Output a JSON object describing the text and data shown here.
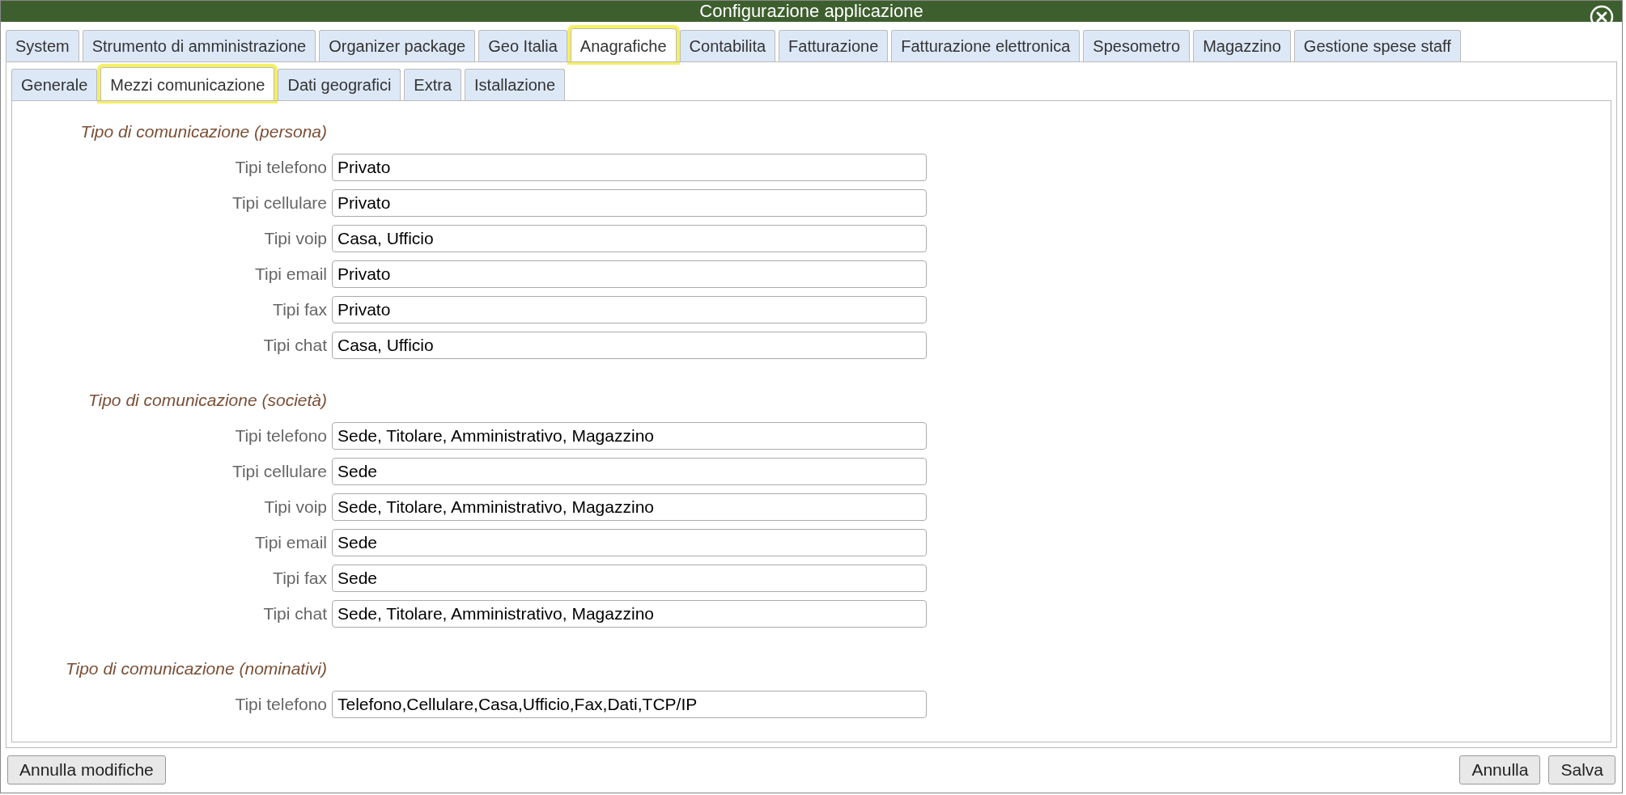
{
  "window": {
    "title": "Configurazione applicazione"
  },
  "tabs": [
    {
      "label": "System",
      "selected": false
    },
    {
      "label": "Strumento di amministrazione",
      "selected": false
    },
    {
      "label": "Organizer package",
      "selected": false
    },
    {
      "label": "Geo Italia",
      "selected": false
    },
    {
      "label": "Anagrafiche",
      "selected": true
    },
    {
      "label": "Contabilita",
      "selected": false
    },
    {
      "label": "Fatturazione",
      "selected": false
    },
    {
      "label": "Fatturazione elettronica",
      "selected": false
    },
    {
      "label": "Spesometro",
      "selected": false
    },
    {
      "label": "Magazzino",
      "selected": false
    },
    {
      "label": "Gestione spese staff",
      "selected": false
    }
  ],
  "subtabs": [
    {
      "label": "Generale",
      "selected": false
    },
    {
      "label": "Mezzi comunicazione",
      "selected": true
    },
    {
      "label": "Dati geografici",
      "selected": false
    },
    {
      "label": "Extra",
      "selected": false
    },
    {
      "label": "Istallazione",
      "selected": false
    }
  ],
  "sections": [
    {
      "heading": "Tipo di comunicazione (persona)",
      "fields": [
        {
          "label": "Tipi telefono",
          "value": "Privato"
        },
        {
          "label": "Tipi cellulare",
          "value": "Privato"
        },
        {
          "label": "Tipi voip",
          "value": "Casa, Ufficio"
        },
        {
          "label": "Tipi email",
          "value": "Privato"
        },
        {
          "label": "Tipi fax",
          "value": "Privato"
        },
        {
          "label": "Tipi chat",
          "value": "Casa, Ufficio"
        }
      ]
    },
    {
      "heading": "Tipo di comunicazione (società)",
      "fields": [
        {
          "label": "Tipi telefono",
          "value": "Sede, Titolare, Amministrativo, Magazzino"
        },
        {
          "label": "Tipi cellulare",
          "value": "Sede"
        },
        {
          "label": "Tipi voip",
          "value": "Sede, Titolare, Amministrativo, Magazzino"
        },
        {
          "label": "Tipi email",
          "value": "Sede"
        },
        {
          "label": "Tipi fax",
          "value": "Sede"
        },
        {
          "label": "Tipi chat",
          "value": "Sede, Titolare, Amministrativo, Magazzino"
        }
      ]
    },
    {
      "heading": "Tipo di comunicazione (nominativi)",
      "fields": [
        {
          "label": "Tipi telefono",
          "value": "Telefono,Cellulare,Casa,Ufficio,Fax,Dati,TCP/IP"
        }
      ]
    }
  ],
  "footer": {
    "left_buttons": [
      "Annulla modifiche"
    ],
    "right_buttons": [
      "Annulla",
      "Salva"
    ]
  }
}
